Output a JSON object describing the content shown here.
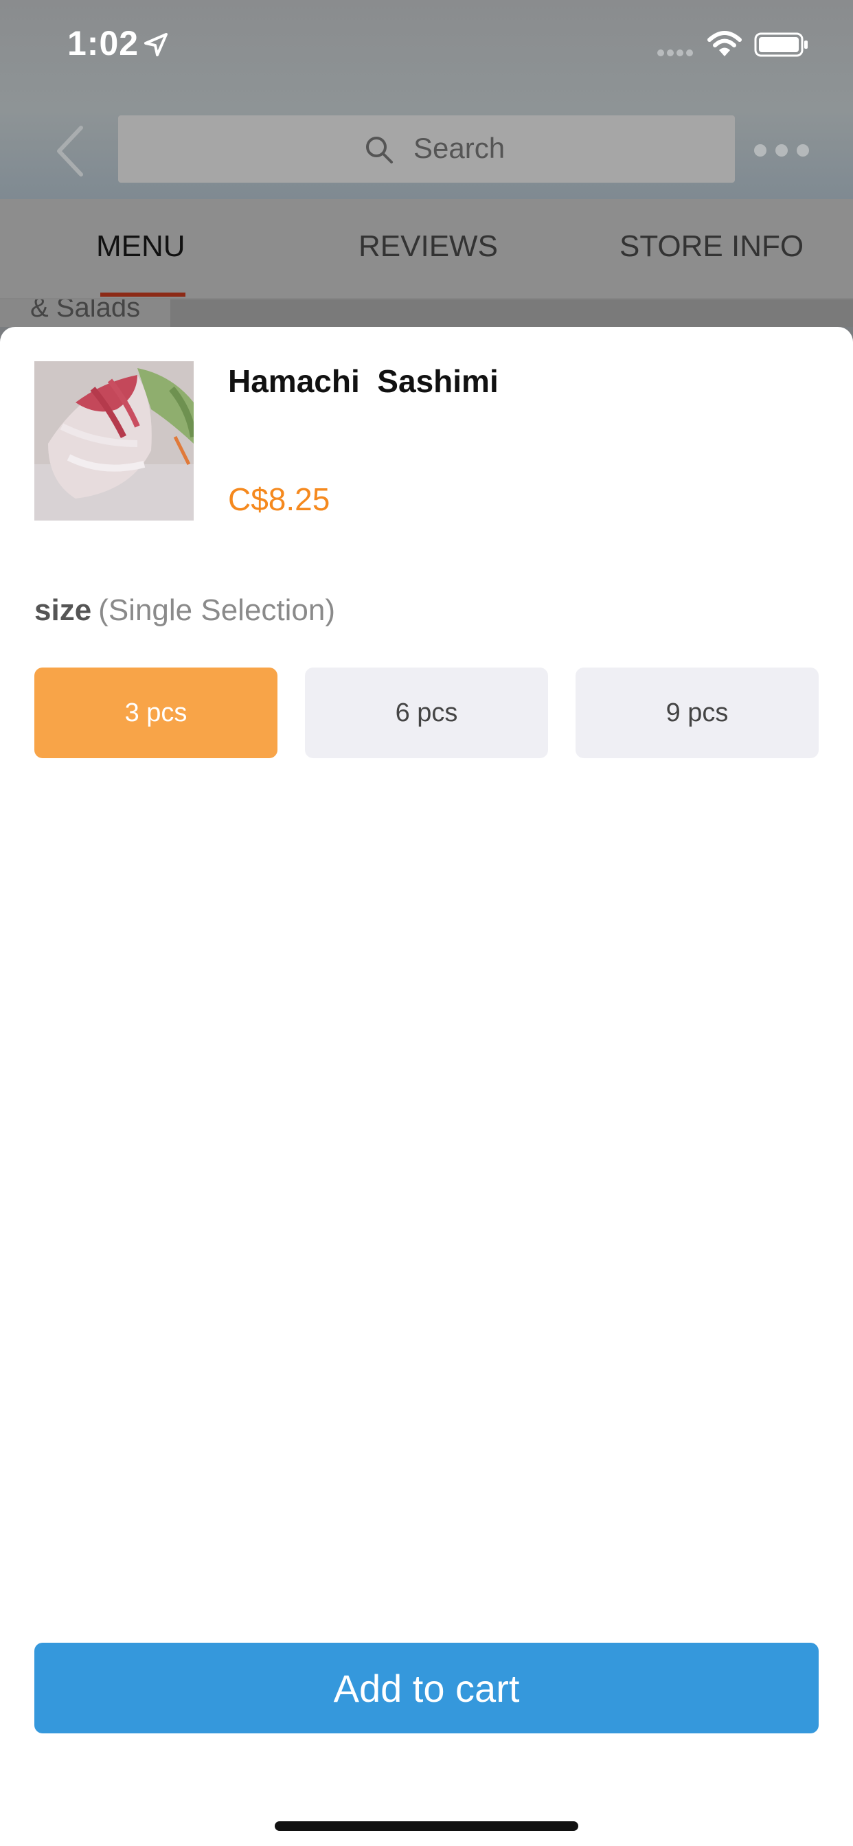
{
  "status_bar": {
    "time": "1:02",
    "icons": [
      "location-arrow-icon",
      "cellular-signal-icon",
      "wifi-icon",
      "battery-icon"
    ]
  },
  "nav": {
    "back_icon": "chevron-left-icon",
    "search_icon": "search-icon",
    "search_label": "Search",
    "more_icon": "more-dots-icon"
  },
  "tabs": [
    {
      "label": "MENU",
      "active": true
    },
    {
      "label": "REVIEWS",
      "active": false
    },
    {
      "label": "STORE INFO",
      "active": false
    }
  ],
  "background": {
    "side_category": "& Salads"
  },
  "item": {
    "name": "Hamachi  Sashimi",
    "price": "C$8.25"
  },
  "option_group": {
    "name": "size",
    "mode": "(Single Selection)",
    "options": [
      {
        "label": "3 pcs",
        "selected": true
      },
      {
        "label": "6 pcs",
        "selected": false
      },
      {
        "label": "9 pcs",
        "selected": false
      }
    ]
  },
  "actions": {
    "add_to_cart": "Add to cart"
  },
  "colors": {
    "price": "#f5891e",
    "selected_option": "#f8a448",
    "unselected_option": "#efeff4",
    "primary_button": "#3598dc",
    "tab_underline": "#8c2a16"
  }
}
